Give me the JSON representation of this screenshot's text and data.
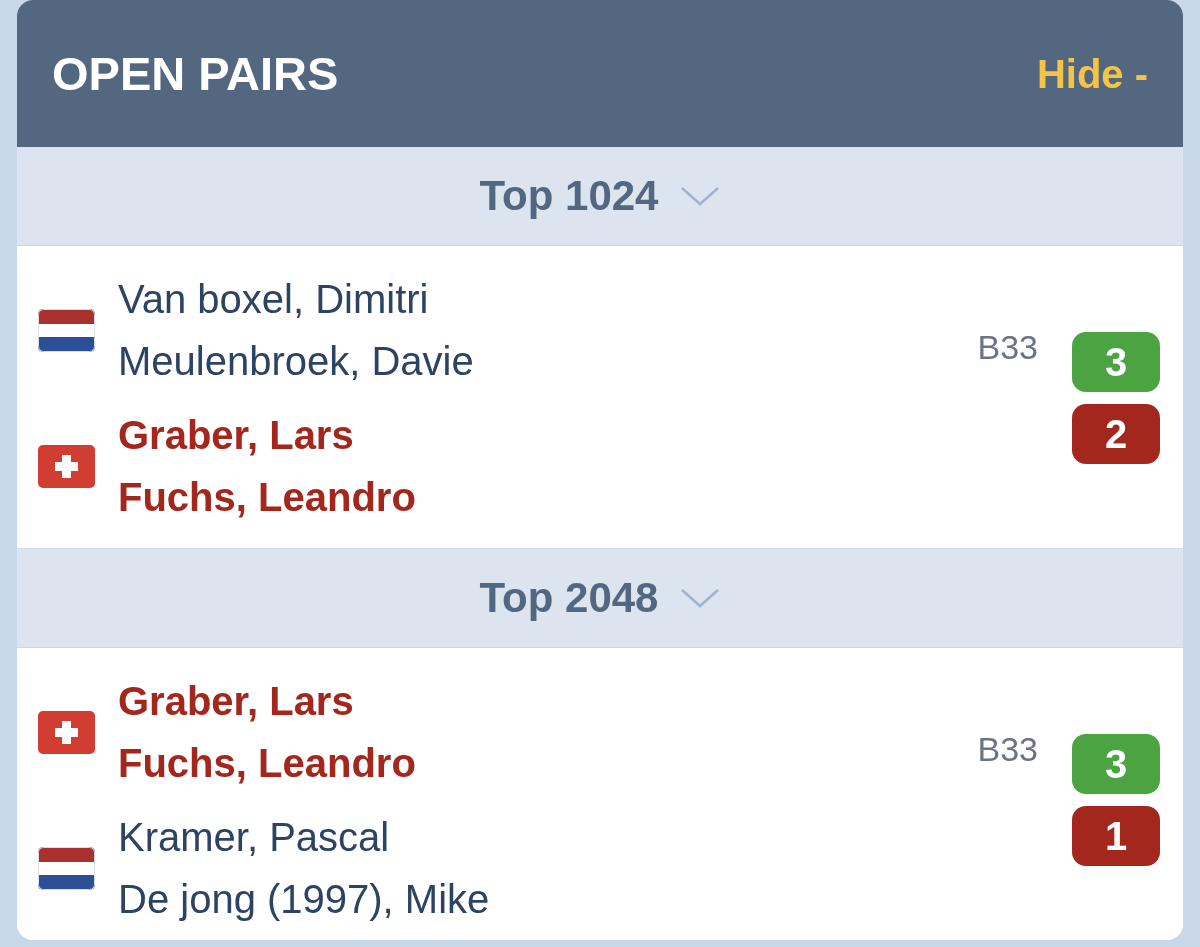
{
  "panel": {
    "title": "OPEN PAIRS",
    "toggle": "Hide -"
  },
  "rounds": [
    {
      "label": "Top 1024",
      "match": {
        "pairs": [
          {
            "flag": {
              "kind": "netherlands"
            },
            "highlighted": false,
            "players": [
              "Van boxel, Dimitri",
              "Meulenbroek, Davie"
            ]
          },
          {
            "flag": {
              "kind": "switzerland"
            },
            "highlighted": true,
            "players": [
              "Graber, Lars",
              "Fuchs, Leandro"
            ]
          }
        ],
        "table": "B33",
        "scores": [
          {
            "value": "3",
            "winner": true
          },
          {
            "value": "2",
            "winner": false
          }
        ]
      }
    },
    {
      "label": "Top 2048",
      "match": {
        "pairs": [
          {
            "flag": {
              "kind": "switzerland"
            },
            "highlighted": true,
            "players": [
              "Graber, Lars",
              "Fuchs, Leandro"
            ]
          },
          {
            "flag": {
              "kind": "netherlands"
            },
            "highlighted": false,
            "players": [
              "Kramer, Pascal",
              "De jong (1997), Mike"
            ]
          }
        ],
        "table": "B33",
        "scores": [
          {
            "value": "3",
            "winner": true
          },
          {
            "value": "1",
            "winner": false
          }
        ]
      }
    }
  ]
}
